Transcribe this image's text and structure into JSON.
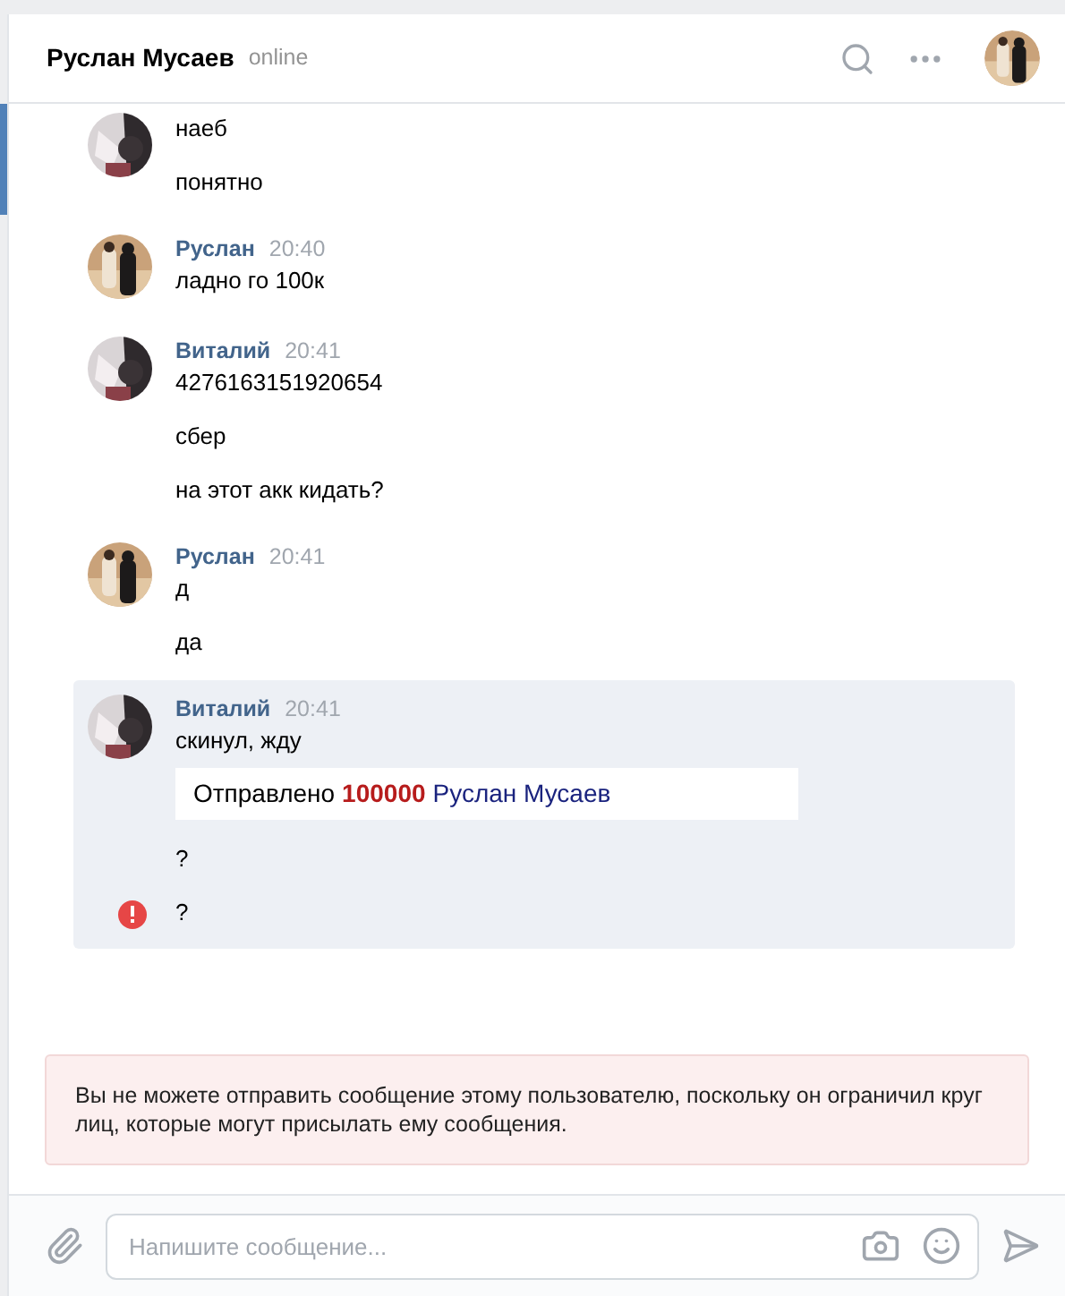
{
  "header": {
    "name": "Руслан Мусаев",
    "status": "online"
  },
  "groups": [
    {
      "selected": false,
      "kind": "self",
      "messages": [
        {
          "kind": "text",
          "text": "наеб",
          "failed": false
        },
        {
          "kind": "text",
          "text": "понятно",
          "failed": false
        }
      ]
    },
    {
      "author": "Руслан",
      "time": "20:40",
      "selected": false,
      "kind": "contact",
      "messages": [
        {
          "kind": "text",
          "text": "ладно го 100к",
          "failed": false
        }
      ]
    },
    {
      "author": "Виталий",
      "time": "20:41",
      "selected": false,
      "kind": "self",
      "messages": [
        {
          "kind": "text",
          "text": "4276163151920654",
          "failed": false
        },
        {
          "kind": "text",
          "text": "сбер",
          "failed": false
        },
        {
          "kind": "text",
          "text": "на этот акк кидать?",
          "failed": false
        }
      ]
    },
    {
      "author": "Руслан",
      "time": "20:41",
      "selected": false,
      "kind": "contact",
      "messages": [
        {
          "kind": "text",
          "text": "д",
          "failed": false
        },
        {
          "kind": "text",
          "text": "да",
          "failed": false
        }
      ]
    },
    {
      "author": "Виталий",
      "time": "20:41",
      "selected": true,
      "kind": "self",
      "messages": [
        {
          "kind": "text",
          "text": "скинул, жду",
          "failed": false
        },
        {
          "kind": "transfer",
          "label": "Отправлено",
          "amount": "100000",
          "recipient": "Руслан Мусаев",
          "failed": false
        },
        {
          "kind": "text",
          "text": "?",
          "failed": false
        },
        {
          "kind": "text",
          "text": "?",
          "failed": true
        }
      ]
    }
  ],
  "notice": "Вы не можете отправить сообщение этому пользователю, поскольку он ограничил круг лиц, которые могут присылать ему сообщения.",
  "composer": {
    "placeholder": "Напишите сообщение..."
  }
}
